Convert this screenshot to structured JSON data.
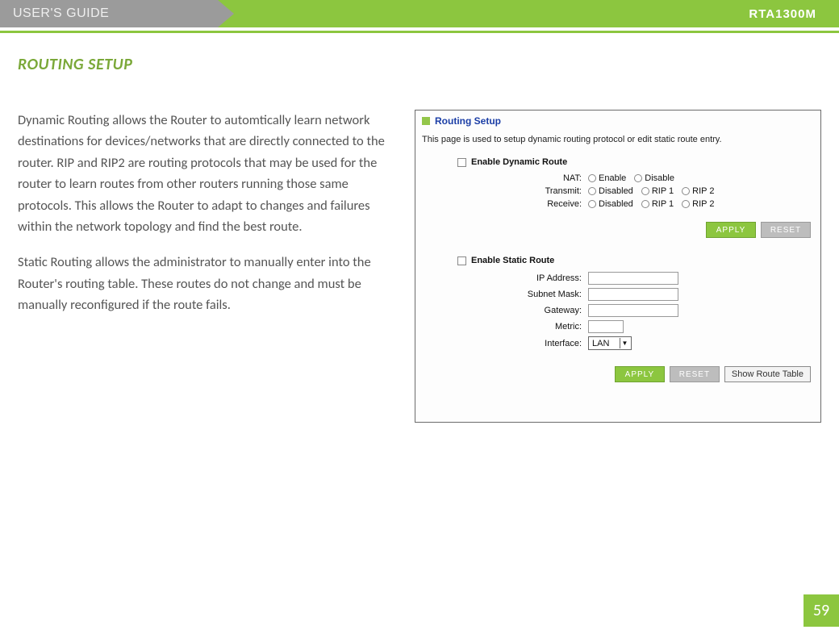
{
  "header": {
    "guide_label": "USER'S GUIDE",
    "model": "RTA1300M"
  },
  "section": {
    "title": "ROUTING SETUP",
    "para1": "Dynamic Routing allows the Router to automtically learn network destinations for devices/networks that are directly connected to the router. RIP and RIP2 are routing protocols that may be used for the router to learn routes from other routers running those same protocols. This allows the Router to adapt to changes and failures within the network topology and find the best route.",
    "para2": "Static Routing allows the administrator to manually enter into the Router's routing table. These routes do not change and must be manually reconfigured if the route fails."
  },
  "panel": {
    "title": "Routing Setup",
    "desc": "This page is used to setup dynamic routing protocol or edit static route entry.",
    "dynamic": {
      "enable_label": "Enable Dynamic Route",
      "nat_label": "NAT:",
      "nat_options": [
        "Enable",
        "Disable"
      ],
      "transmit_label": "Transmit:",
      "transmit_options": [
        "Disabled",
        "RIP 1",
        "RIP 2"
      ],
      "receive_label": "Receive:",
      "receive_options": [
        "Disabled",
        "RIP 1",
        "RIP 2"
      ]
    },
    "static": {
      "enable_label": "Enable Static Route",
      "ip_label": "IP Address:",
      "mask_label": "Subnet Mask:",
      "gateway_label": "Gateway:",
      "metric_label": "Metric:",
      "interface_label": "Interface:",
      "interface_value": "LAN"
    },
    "buttons": {
      "apply": "APPLY",
      "reset": "RESET",
      "show_route": "Show Route Table"
    }
  },
  "page_number": "59"
}
